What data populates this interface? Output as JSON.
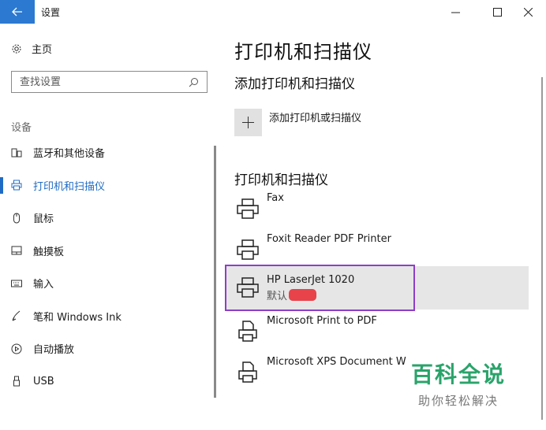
{
  "window": {
    "title": "设置"
  },
  "sidebar": {
    "home_label": "主页",
    "search_placeholder": "查找设置",
    "section_label": "设备",
    "items": [
      {
        "label": "蓝牙和其他设备",
        "icon": "bluetooth-devices-icon"
      },
      {
        "label": "打印机和扫描仪",
        "icon": "printer-icon",
        "active": true
      },
      {
        "label": "鼠标",
        "icon": "mouse-icon"
      },
      {
        "label": "触摸板",
        "icon": "touchpad-icon"
      },
      {
        "label": "输入",
        "icon": "keyboard-icon"
      },
      {
        "label": "笔和 Windows Ink",
        "icon": "pen-icon"
      },
      {
        "label": "自动播放",
        "icon": "autoplay-icon"
      },
      {
        "label": "USB",
        "icon": "usb-icon"
      }
    ]
  },
  "main": {
    "title": "打印机和扫描仪",
    "add_section_title": "添加打印机和扫描仪",
    "add_button_label": "添加打印机或扫描仪",
    "list_section_title": "打印机和扫描仪",
    "printers": [
      {
        "name": "Fax",
        "icon": "printer-icon"
      },
      {
        "name": "Foxit Reader PDF Printer",
        "icon": "printer-icon"
      },
      {
        "name": "HP LaserJet 1020",
        "status": "默认",
        "icon": "printer-icon",
        "selected": true
      },
      {
        "name": "Microsoft Print to PDF",
        "icon": "document-printer-icon"
      },
      {
        "name": "Microsoft XPS Document W",
        "icon": "document-printer-icon"
      }
    ]
  },
  "watermark": {
    "main": "百科全说",
    "sub": "助你轻松解决"
  },
  "colors": {
    "accent": "#1f6bc4",
    "back_button": "#2b79d0",
    "selected_row": "#e6e6e6",
    "highlight_outline": "#8d3fc8",
    "redaction": "#e8434b",
    "watermark": "#2aa36b"
  }
}
